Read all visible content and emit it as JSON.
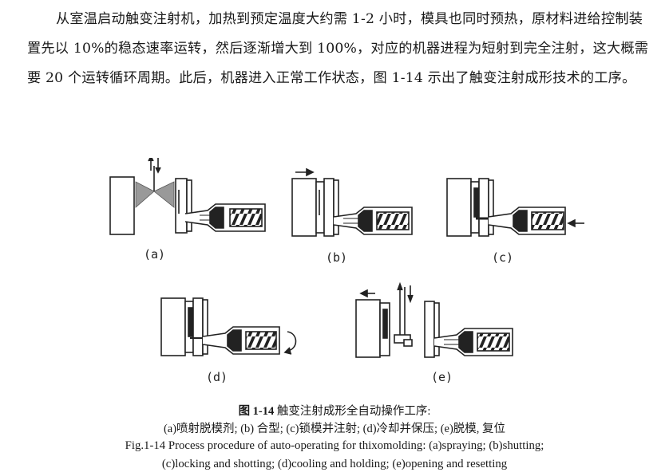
{
  "paragraph": {
    "text": "从室温启动触变注射机，加热到预定温度大约需 1-2 小时，模具也同时预热，原材料进给控制装置先以 10%的稳态速率运转，然后逐渐增大到 100%，对应的机器进程为短射到完全注射，这大概需要 20 个运转循环周期。此后，机器进入正常工作状态，图 1-14 示出了触变注射成形技术的工序。"
  },
  "figure": {
    "panel_labels": [
      "(a)",
      "(b)",
      "(c)",
      "(d)",
      "(e)"
    ]
  },
  "caption": {
    "cn_number": "图 1-14",
    "cn_title": "触变注射成形全自动操作工序:",
    "cn_line2": "(a)喷射脱模剂; (b) 合型; (c)锁模并注射; (d)冷却并保压; (e)脱模, 复位",
    "en_line1": "Fig.1-14 Process procedure of auto-operating for thixomolding: (a)spraying; (b)shutting;",
    "en_line2": "(c)locking and shotting; (d)cooling and holding; (e)opening and resetting"
  }
}
